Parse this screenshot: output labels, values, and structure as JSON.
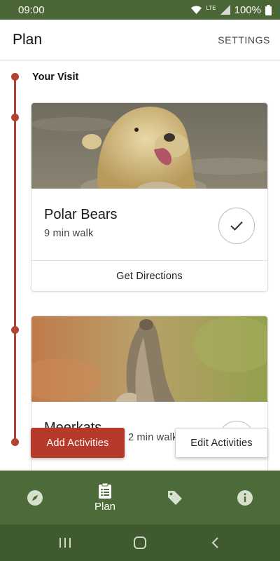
{
  "status_bar": {
    "time": "09:00",
    "network": "LTE",
    "battery": "100%"
  },
  "app_bar": {
    "title": "Plan",
    "settings_label": "SETTINGS"
  },
  "plan": {
    "section_title": "Your Visit",
    "cards": [
      {
        "title": "Polar Bears",
        "subtitle": "9 min walk",
        "action_label": "Get Directions",
        "image": "polar-bear-photo",
        "completed": true
      },
      {
        "title": "Meerkats",
        "subtitle": "2 min walk",
        "image": "meerkat-photo",
        "completed": false
      }
    ]
  },
  "actions": {
    "add_label": "Add Activities",
    "edit_label": "Edit Activities"
  },
  "bottom_nav": {
    "items": [
      {
        "icon": "compass-icon",
        "label": ""
      },
      {
        "icon": "clipboard-list-icon",
        "label": "Plan",
        "active": true
      },
      {
        "icon": "tag-icon",
        "label": ""
      },
      {
        "icon": "info-icon",
        "label": ""
      }
    ]
  },
  "system_nav": {
    "buttons": [
      "recents-icon",
      "home-icon",
      "back-icon"
    ]
  },
  "colors": {
    "primary_green": "#4c6b38",
    "accent_red": "#b53a2c",
    "timeline_red": "#b14334"
  }
}
